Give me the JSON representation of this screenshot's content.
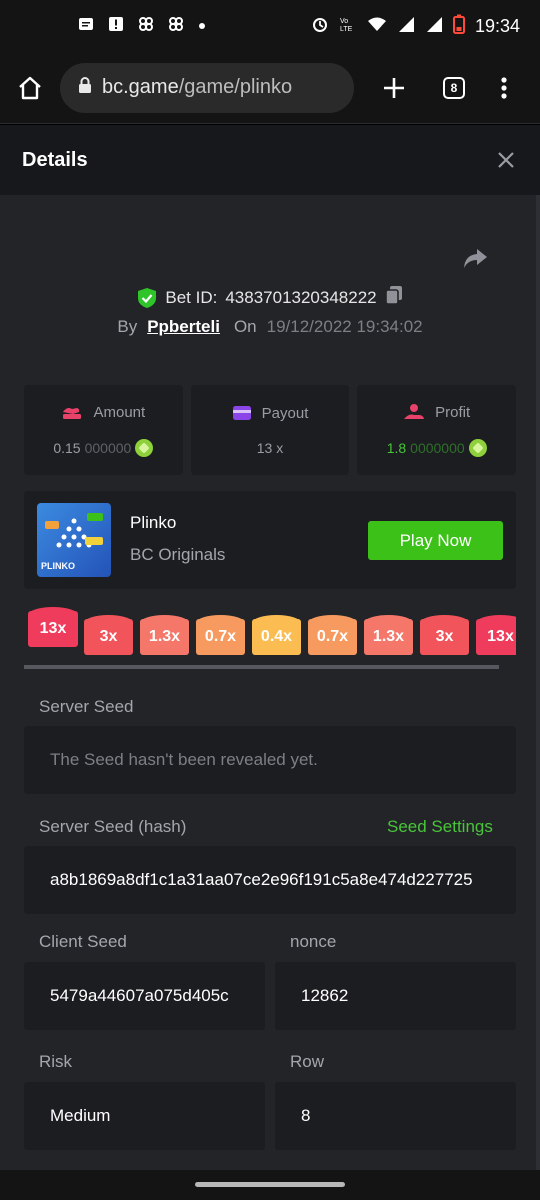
{
  "status_bar": {
    "time": "19:34",
    "icons_left": [
      "message-icon",
      "alert-icon",
      "app-icon",
      "app-icon",
      "dot-icon"
    ],
    "icons_right": [
      "alarm-icon",
      "volte-icon",
      "wifi-icon",
      "signal-icon",
      "signal-icon",
      "battery-low-icon"
    ]
  },
  "browser": {
    "url_host": "bc.game",
    "url_path": "/game/plinko",
    "tabs_count": "8"
  },
  "details": {
    "title": "Details"
  },
  "bet": {
    "id_label": "Bet ID:",
    "id_value": "4383701320348222",
    "by_label": "By",
    "user": "Ppberteli",
    "on_label": "On",
    "date": "19/12/2022 19:34:02"
  },
  "stats": {
    "amount": {
      "label": "Amount",
      "value_main": "0.15",
      "value_muted": "000000"
    },
    "payout": {
      "label": "Payout",
      "value": "13 x"
    },
    "profit": {
      "label": "Profit",
      "value_main": "1.8",
      "value_muted": "0000000"
    }
  },
  "game": {
    "thumb_label": "PLINKO",
    "name": "Plinko",
    "provider": "BC Originals",
    "play_label": "Play Now"
  },
  "multipliers": [
    {
      "label": "13x",
      "color": "#ef3b5c",
      "active": true
    },
    {
      "label": "3x",
      "color": "#f2545b",
      "active": false
    },
    {
      "label": "1.3x",
      "color": "#f4776a",
      "active": false
    },
    {
      "label": "0.7x",
      "color": "#f79a5f",
      "active": false
    },
    {
      "label": "0.4x",
      "color": "#fbbd52",
      "active": false
    },
    {
      "label": "0.7x",
      "color": "#f79a5f",
      "active": false
    },
    {
      "label": "1.3x",
      "color": "#f4776a",
      "active": false
    },
    {
      "label": "3x",
      "color": "#f2545b",
      "active": false
    },
    {
      "label": "13x",
      "color": "#ef3b5c",
      "active": false
    }
  ],
  "fields": {
    "server_seed": {
      "label": "Server Seed",
      "value": "The Seed hasn't been revealed yet."
    },
    "server_seed_hash": {
      "label": "Server Seed (hash)",
      "value": "a8b1869a8df1c1a31aa07ce2e96f191c5a8e474d227725",
      "settings_label": "Seed Settings"
    },
    "client_seed": {
      "label": "Client Seed",
      "value": "5479a44607a075d405c"
    },
    "nonce": {
      "label": "nonce",
      "value": "12862"
    },
    "risk": {
      "label": "Risk",
      "value": "Medium"
    },
    "row": {
      "label": "Row",
      "value": "8"
    }
  },
  "colors": {
    "accent_green": "#3bc117",
    "panel_bg": "#232428",
    "card_bg": "#1c1d21"
  }
}
